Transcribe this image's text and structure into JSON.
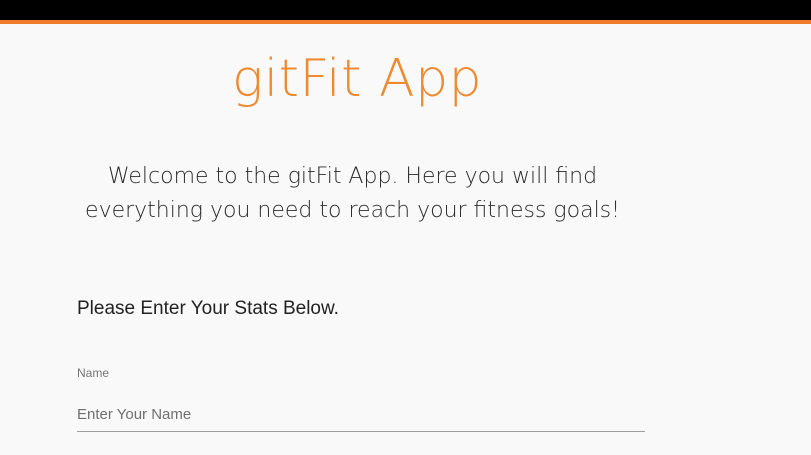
{
  "header": {
    "bar_color": "#000000",
    "accent_color": "#ee7c2b"
  },
  "app": {
    "title": "gitFit App",
    "title_color": "#ee8a2f",
    "welcome": "Welcome to the gitFit App. Here you will find everything you need to reach your fitness goals!"
  },
  "form": {
    "heading": "Please Enter Your Stats Below.",
    "name_field": {
      "label": "Name",
      "placeholder": "Enter Your Name",
      "value": ""
    }
  }
}
